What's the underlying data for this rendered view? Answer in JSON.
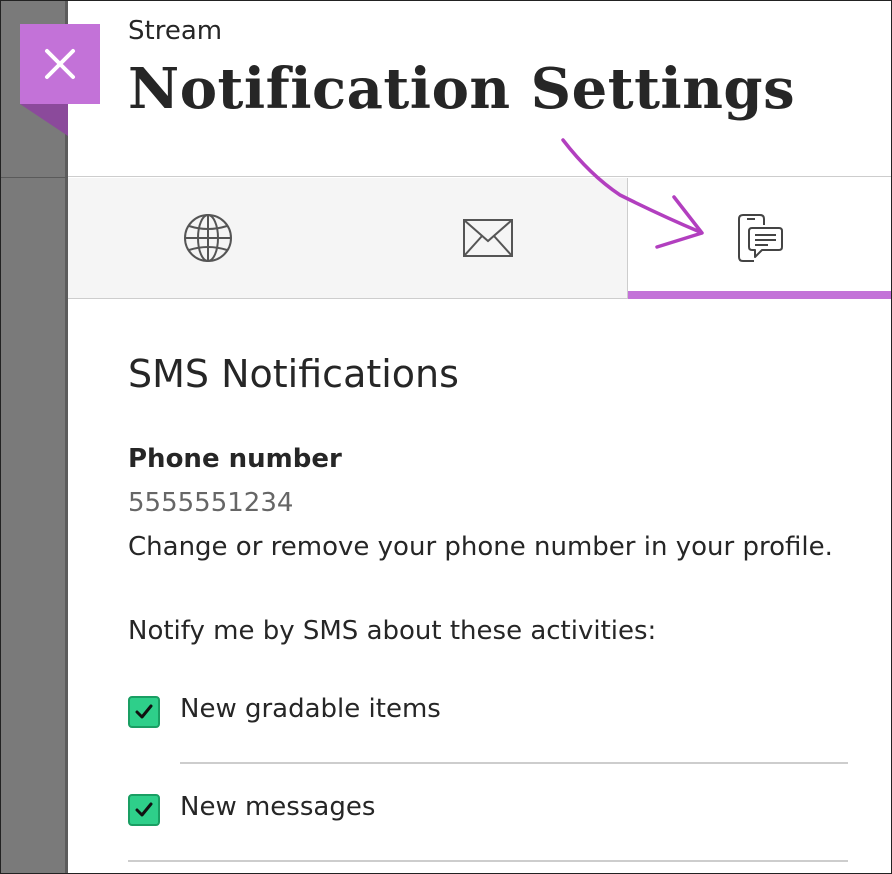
{
  "panel": {
    "close_icon": "close-x-icon",
    "subtitle": "Stream",
    "title": "Notification Settings"
  },
  "tabs": [
    {
      "id": "web",
      "icon": "globe-icon",
      "active": false
    },
    {
      "id": "email",
      "icon": "envelope-icon",
      "active": false
    },
    {
      "id": "sms",
      "icon": "phone-message-icon",
      "active": true
    }
  ],
  "sms": {
    "section_title": "SMS Notifications",
    "phone_label": "Phone number",
    "phone_value": "5555551234",
    "phone_help": "Change or remove your phone number in your profile.",
    "notify_prompt": "Notify me by SMS about these activities:",
    "options": [
      {
        "label": "New gradable items",
        "checked": true
      },
      {
        "label": "New messages",
        "checked": true
      }
    ]
  },
  "colors": {
    "accent": "#c372d8",
    "checkbox": "#2ecf8a",
    "annotation_arrow": "#b23fbf"
  }
}
